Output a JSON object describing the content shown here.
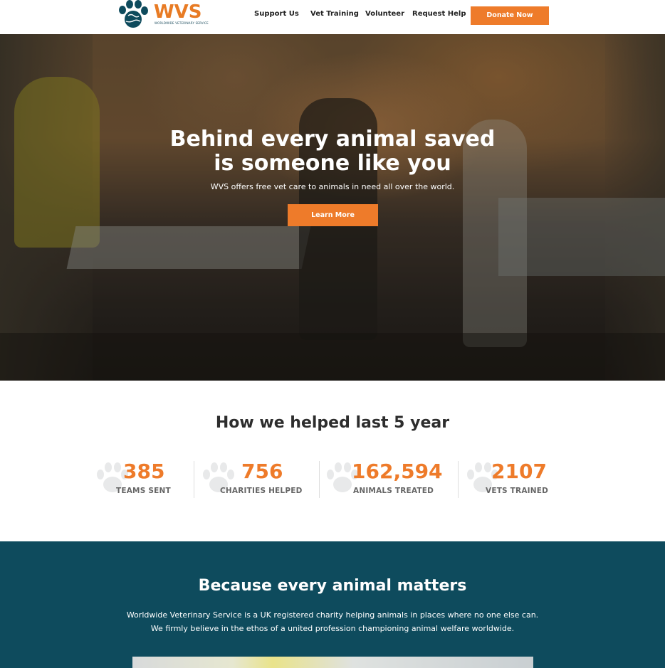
{
  "brand": {
    "logo_text": "WVS",
    "logo_subtitle": "WORLDWIDE VETERINARY SERVICE",
    "primary_color": "#0e4b5d",
    "accent_color": "#ee7b2a"
  },
  "nav": {
    "items": [
      {
        "label": "Support Us"
      },
      {
        "label": "Vet Training"
      },
      {
        "label": "Volunteer"
      },
      {
        "label": "Request Help"
      }
    ],
    "donate_label": "Donate Now"
  },
  "hero": {
    "title_line1": "Behind every animal saved",
    "title_line2": "is someone like you",
    "subtitle": "WVS offers free vet care to animals in need all over the world.",
    "cta_label": "Learn More"
  },
  "stats": {
    "title": "How we helped last 5 year",
    "items": [
      {
        "value": "385",
        "label": "TEAMS SENT",
        "icon": "paw-icon"
      },
      {
        "value": "756",
        "label": "CHARITIES HELPED",
        "icon": "paw-icon"
      },
      {
        "value": "162,594",
        "label": "ANIMALS TREATED",
        "icon": "paw-icon"
      },
      {
        "value": "2107",
        "label": "VETS TRAINED",
        "icon": "paw-icon"
      }
    ]
  },
  "mission": {
    "title": "Because every animal matters",
    "line1": "Worldwide Veterinary Service is a UK registered charity helping animals in places where no one else can.",
    "line2": "We firmly believe in the ethos of a united profession championing animal welfare worldwide."
  }
}
